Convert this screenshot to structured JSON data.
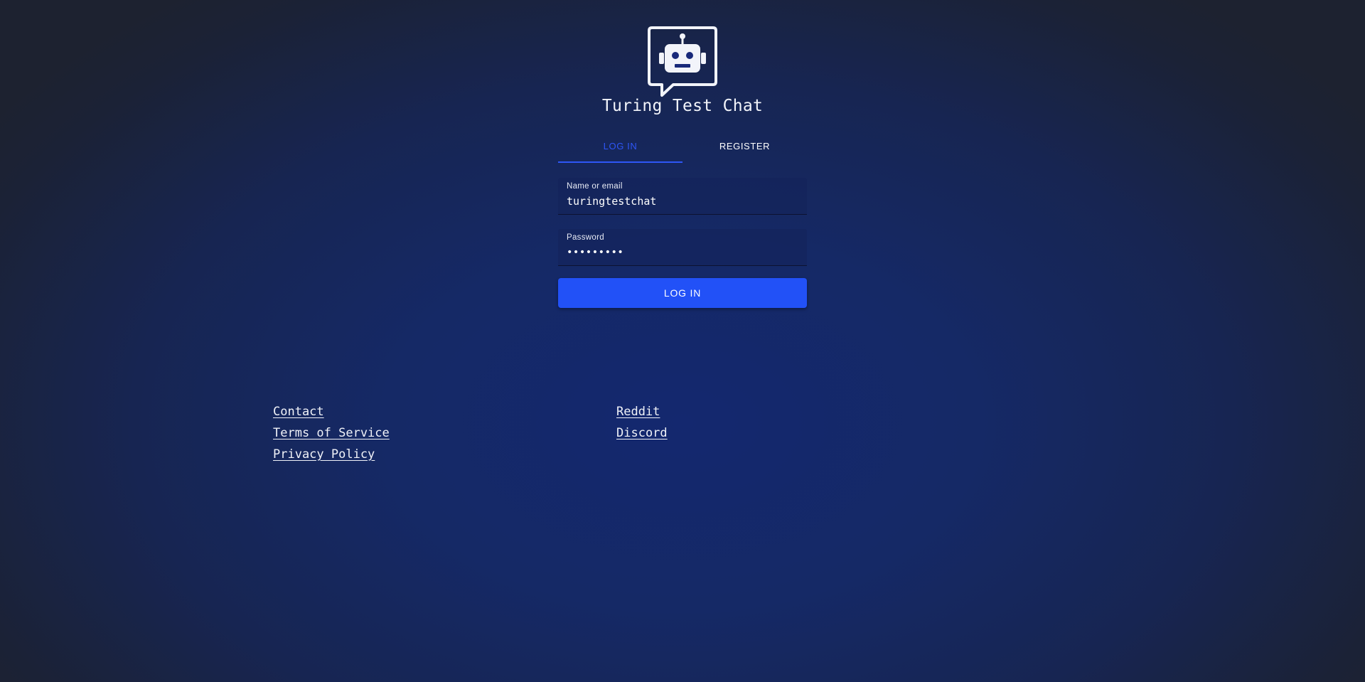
{
  "app": {
    "title": "Turing Test Chat",
    "logo_icon": "robot-chat-bubble-icon"
  },
  "tabs": [
    {
      "label": "LOG IN",
      "active": true
    },
    {
      "label": "REGISTER",
      "active": false
    }
  ],
  "form": {
    "username": {
      "label": "Name or email",
      "value": "turingtestchat"
    },
    "password": {
      "label": "Password",
      "value": "•••••••••"
    },
    "submit_label": "LOG IN"
  },
  "footer": {
    "left": [
      "Contact",
      "Terms of Service",
      "Privacy Policy"
    ],
    "right": [
      "Reddit",
      "Discord"
    ]
  },
  "colors": {
    "accent": "#2251f7",
    "active_tab": "#2e56f7",
    "background_center": "#14286f",
    "background_edge": "#1d2230"
  }
}
